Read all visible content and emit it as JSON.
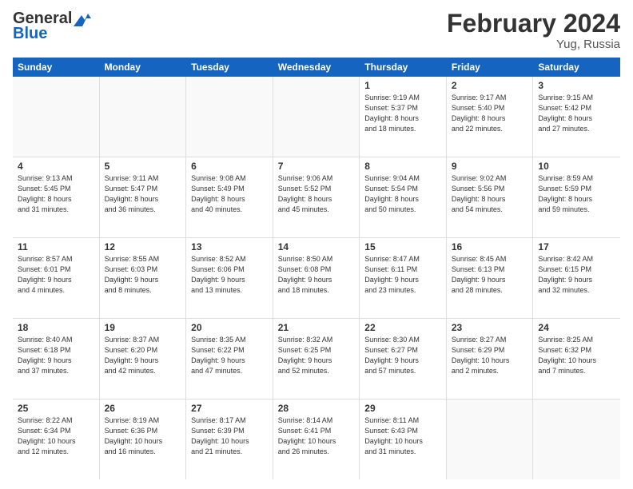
{
  "header": {
    "logo_general": "General",
    "logo_blue": "Blue",
    "month_title": "February 2024",
    "subtitle": "Yug, Russia"
  },
  "days_of_week": [
    "Sunday",
    "Monday",
    "Tuesday",
    "Wednesday",
    "Thursday",
    "Friday",
    "Saturday"
  ],
  "weeks": [
    [
      {
        "day": "",
        "info": ""
      },
      {
        "day": "",
        "info": ""
      },
      {
        "day": "",
        "info": ""
      },
      {
        "day": "",
        "info": ""
      },
      {
        "day": "1",
        "info": "Sunrise: 9:19 AM\nSunset: 5:37 PM\nDaylight: 8 hours\nand 18 minutes."
      },
      {
        "day": "2",
        "info": "Sunrise: 9:17 AM\nSunset: 5:40 PM\nDaylight: 8 hours\nand 22 minutes."
      },
      {
        "day": "3",
        "info": "Sunrise: 9:15 AM\nSunset: 5:42 PM\nDaylight: 8 hours\nand 27 minutes."
      }
    ],
    [
      {
        "day": "4",
        "info": "Sunrise: 9:13 AM\nSunset: 5:45 PM\nDaylight: 8 hours\nand 31 minutes."
      },
      {
        "day": "5",
        "info": "Sunrise: 9:11 AM\nSunset: 5:47 PM\nDaylight: 8 hours\nand 36 minutes."
      },
      {
        "day": "6",
        "info": "Sunrise: 9:08 AM\nSunset: 5:49 PM\nDaylight: 8 hours\nand 40 minutes."
      },
      {
        "day": "7",
        "info": "Sunrise: 9:06 AM\nSunset: 5:52 PM\nDaylight: 8 hours\nand 45 minutes."
      },
      {
        "day": "8",
        "info": "Sunrise: 9:04 AM\nSunset: 5:54 PM\nDaylight: 8 hours\nand 50 minutes."
      },
      {
        "day": "9",
        "info": "Sunrise: 9:02 AM\nSunset: 5:56 PM\nDaylight: 8 hours\nand 54 minutes."
      },
      {
        "day": "10",
        "info": "Sunrise: 8:59 AM\nSunset: 5:59 PM\nDaylight: 8 hours\nand 59 minutes."
      }
    ],
    [
      {
        "day": "11",
        "info": "Sunrise: 8:57 AM\nSunset: 6:01 PM\nDaylight: 9 hours\nand 4 minutes."
      },
      {
        "day": "12",
        "info": "Sunrise: 8:55 AM\nSunset: 6:03 PM\nDaylight: 9 hours\nand 8 minutes."
      },
      {
        "day": "13",
        "info": "Sunrise: 8:52 AM\nSunset: 6:06 PM\nDaylight: 9 hours\nand 13 minutes."
      },
      {
        "day": "14",
        "info": "Sunrise: 8:50 AM\nSunset: 6:08 PM\nDaylight: 9 hours\nand 18 minutes."
      },
      {
        "day": "15",
        "info": "Sunrise: 8:47 AM\nSunset: 6:11 PM\nDaylight: 9 hours\nand 23 minutes."
      },
      {
        "day": "16",
        "info": "Sunrise: 8:45 AM\nSunset: 6:13 PM\nDaylight: 9 hours\nand 28 minutes."
      },
      {
        "day": "17",
        "info": "Sunrise: 8:42 AM\nSunset: 6:15 PM\nDaylight: 9 hours\nand 32 minutes."
      }
    ],
    [
      {
        "day": "18",
        "info": "Sunrise: 8:40 AM\nSunset: 6:18 PM\nDaylight: 9 hours\nand 37 minutes."
      },
      {
        "day": "19",
        "info": "Sunrise: 8:37 AM\nSunset: 6:20 PM\nDaylight: 9 hours\nand 42 minutes."
      },
      {
        "day": "20",
        "info": "Sunrise: 8:35 AM\nSunset: 6:22 PM\nDaylight: 9 hours\nand 47 minutes."
      },
      {
        "day": "21",
        "info": "Sunrise: 8:32 AM\nSunset: 6:25 PM\nDaylight: 9 hours\nand 52 minutes."
      },
      {
        "day": "22",
        "info": "Sunrise: 8:30 AM\nSunset: 6:27 PM\nDaylight: 9 hours\nand 57 minutes."
      },
      {
        "day": "23",
        "info": "Sunrise: 8:27 AM\nSunset: 6:29 PM\nDaylight: 10 hours\nand 2 minutes."
      },
      {
        "day": "24",
        "info": "Sunrise: 8:25 AM\nSunset: 6:32 PM\nDaylight: 10 hours\nand 7 minutes."
      }
    ],
    [
      {
        "day": "25",
        "info": "Sunrise: 8:22 AM\nSunset: 6:34 PM\nDaylight: 10 hours\nand 12 minutes."
      },
      {
        "day": "26",
        "info": "Sunrise: 8:19 AM\nSunset: 6:36 PM\nDaylight: 10 hours\nand 16 minutes."
      },
      {
        "day": "27",
        "info": "Sunrise: 8:17 AM\nSunset: 6:39 PM\nDaylight: 10 hours\nand 21 minutes."
      },
      {
        "day": "28",
        "info": "Sunrise: 8:14 AM\nSunset: 6:41 PM\nDaylight: 10 hours\nand 26 minutes."
      },
      {
        "day": "29",
        "info": "Sunrise: 8:11 AM\nSunset: 6:43 PM\nDaylight: 10 hours\nand 31 minutes."
      },
      {
        "day": "",
        "info": ""
      },
      {
        "day": "",
        "info": ""
      }
    ]
  ]
}
